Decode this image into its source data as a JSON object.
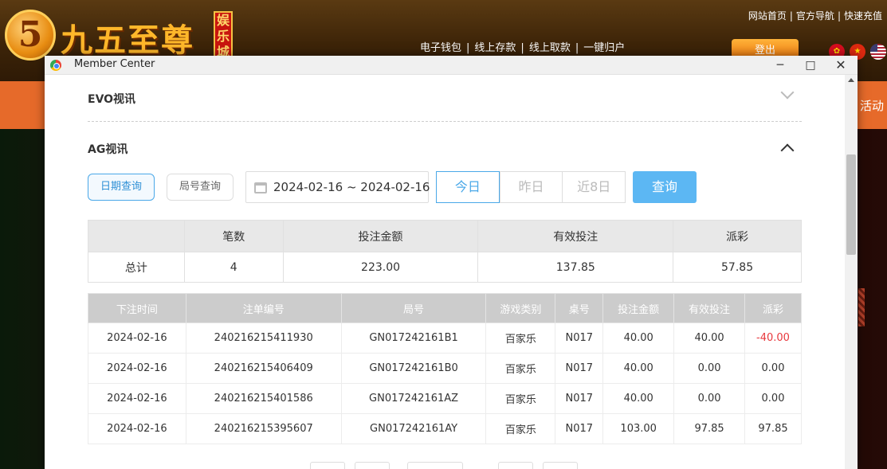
{
  "site": {
    "logo_digit": "5",
    "logo_text": "九五至尊",
    "logo_badge": "娱乐城",
    "top_links": [
      "网站首页",
      "官方导航",
      "快速充值"
    ],
    "wallet_links": [
      "电子钱包",
      "线上存款",
      "线上取款",
      "一键归户"
    ],
    "logout": "登出",
    "nav_right": "活动",
    "accent_orange": "#e66a2a"
  },
  "window": {
    "title": "Member Center",
    "minimize": "─",
    "maximize": "□",
    "close": "✕"
  },
  "sections": {
    "evo": {
      "label": "EVO视讯",
      "expanded": false
    },
    "ag": {
      "label": "AG视讯",
      "expanded": true
    }
  },
  "filters": {
    "date_query": "日期查询",
    "round_query": "局号查询",
    "date_range": "2024-02-16 ~ 2024-02-16",
    "today": "今日",
    "yesterday": "昨日",
    "last8": "近8日",
    "search": "查询"
  },
  "summary": {
    "headers": [
      "",
      "笔数",
      "投注金额",
      "有效投注",
      "派彩"
    ],
    "row": [
      "总计",
      "4",
      "223.00",
      "137.85",
      "57.85"
    ]
  },
  "bets": {
    "headers": [
      "下注时间",
      "注单编号",
      "局号",
      "游戏类别",
      "桌号",
      "投注金额",
      "有效投注",
      "派彩"
    ],
    "rows": [
      [
        "2024-02-16",
        "240216215411930",
        "GN017242161B1",
        "百家乐",
        "N017",
        "40.00",
        "40.00",
        "-40.00"
      ],
      [
        "2024-02-16",
        "240216215406409",
        "GN017242161B0",
        "百家乐",
        "N017",
        "40.00",
        "0.00",
        "0.00"
      ],
      [
        "2024-02-16",
        "240216215401586",
        "GN017242161AZ",
        "百家乐",
        "N017",
        "40.00",
        "0.00",
        "0.00"
      ],
      [
        "2024-02-16",
        "240216215395607",
        "GN017242161AY",
        "百家乐",
        "N017",
        "103.00",
        "97.85",
        "97.85"
      ]
    ],
    "negative_color": "#e8383d"
  }
}
